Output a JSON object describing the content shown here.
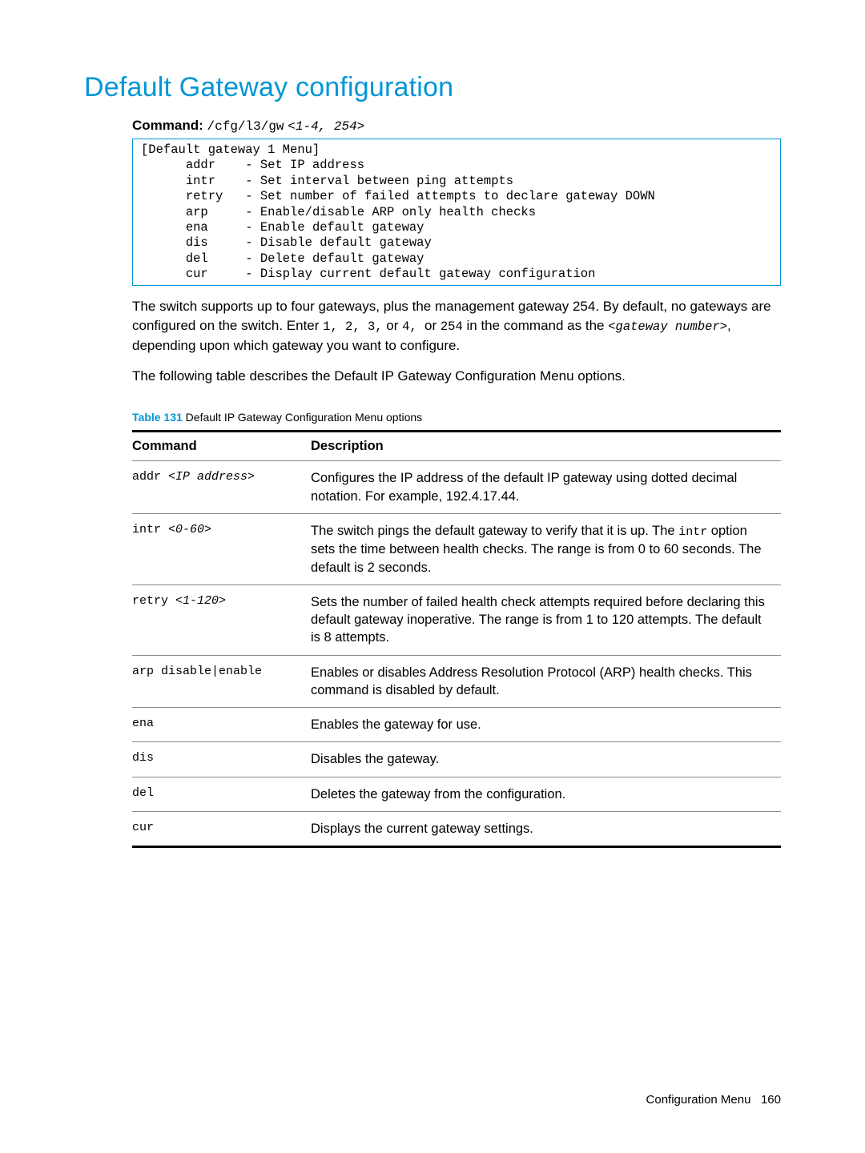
{
  "title": "Default Gateway configuration",
  "command": {
    "label": "Command:",
    "path": "/cfg/l3/gw",
    "args": "<1-4, 254>"
  },
  "menu_header": "[Default gateway 1 Menu]",
  "menu_items": [
    {
      "key": "addr",
      "desc": "- Set IP address"
    },
    {
      "key": "intr",
      "desc": "- Set interval between ping attempts"
    },
    {
      "key": "retry",
      "desc": "- Set number of failed attempts to declare gateway DOWN"
    },
    {
      "key": "arp",
      "desc": "- Enable/disable ARP only health checks"
    },
    {
      "key": "ena",
      "desc": "- Enable default gateway"
    },
    {
      "key": "dis",
      "desc": "- Disable default gateway"
    },
    {
      "key": "del",
      "desc": "- Delete default gateway"
    },
    {
      "key": "cur",
      "desc": "- Display current default gateway configuration"
    }
  ],
  "paragraphs": {
    "p1a": "The switch supports up to four gateways, plus the management gateway 254. By default, no gateways are configured on the switch. Enter ",
    "p1_m1": "1, 2, 3,",
    "p1_mid1": " or ",
    "p1_m2": "4, ",
    "p1_mid2": "or ",
    "p1_m3": "254",
    "p1b": " in the command as the ",
    "p1_gw": "<gateway number>",
    "p1c": ", depending upon which gateway you want to configure.",
    "p2": "The following table describes the Default IP Gateway Configuration Menu options."
  },
  "table": {
    "caption_no": "Table 131",
    "caption_text": "  Default IP Gateway Configuration Menu options",
    "head_cmd": "Command",
    "head_desc": "Description",
    "rows": [
      {
        "cmd_pre": "addr ",
        "cmd_ital": "<IP address>",
        "desc": "Configures the IP address of the default IP gateway using dotted decimal notation. For example, 192.4.17.44."
      },
      {
        "cmd_pre": "intr ",
        "cmd_ital": "<0-60>",
        "desc_pre": "The switch pings the default gateway to verify that it is up. The ",
        "desc_mono": "intr",
        "desc_post": " option sets the time between health checks. The range is from 0 to 60 seconds. The default is 2 seconds."
      },
      {
        "cmd_pre": "retry ",
        "cmd_ital": "<1-120>",
        "desc": "Sets the number of failed health check attempts required before declaring this default gateway inoperative. The range is from 1 to 120 attempts. The default is 8 attempts."
      },
      {
        "cmd_pre": "arp disable|enable",
        "cmd_ital": "",
        "desc": "Enables or disables Address Resolution Protocol (ARP) health checks. This command is disabled by default."
      },
      {
        "cmd_pre": "ena",
        "cmd_ital": "",
        "desc": "Enables the gateway for use."
      },
      {
        "cmd_pre": "dis",
        "cmd_ital": "",
        "desc": "Disables the gateway."
      },
      {
        "cmd_pre": "del",
        "cmd_ital": "",
        "desc": "Deletes the gateway from the configuration."
      },
      {
        "cmd_pre": "cur",
        "cmd_ital": "",
        "desc": "Displays the current gateway settings."
      }
    ]
  },
  "footer": {
    "section": "Configuration Menu",
    "page": "160"
  }
}
